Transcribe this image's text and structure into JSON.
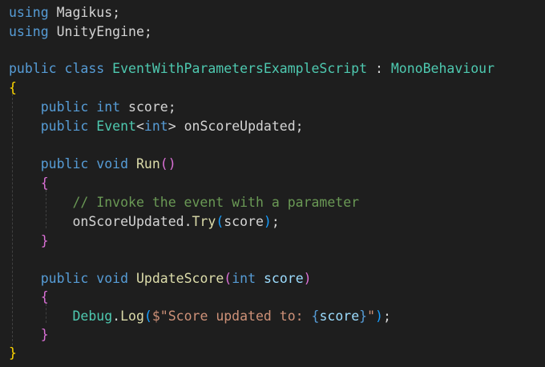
{
  "code": {
    "l1": {
      "kw": "using",
      "ns": "Magikus",
      "semi": ";"
    },
    "l2": {
      "kw": "using",
      "ns": "UnityEngine",
      "semi": ";"
    },
    "l4": {
      "kw1": "public",
      "kw2": "class",
      "name": "EventWithParametersExampleScript",
      "colon": ":",
      "base": "MonoBehaviour"
    },
    "l5": {
      "brace": "{"
    },
    "l6": {
      "kw1": "public",
      "kw2": "int",
      "field": "score",
      "semi": ";"
    },
    "l7": {
      "kw1": "public",
      "type": "Event",
      "lt": "<",
      "targ": "int",
      "gt": ">",
      "field": "onScoreUpdated",
      "semi": ";"
    },
    "l9": {
      "kw1": "public",
      "kw2": "void",
      "name": "Run",
      "parens": "()"
    },
    "l10": {
      "brace": "{"
    },
    "l11": {
      "comment": "// Invoke the event with a parameter"
    },
    "l12": {
      "obj": "onScoreUpdated",
      "dot": ".",
      "method": "Try",
      "open": "(",
      "arg": "score",
      "close": ")",
      "semi": ";"
    },
    "l13": {
      "brace": "}"
    },
    "l15": {
      "kw1": "public",
      "kw2": "void",
      "name": "UpdateScore",
      "open": "(",
      "ptype": "int",
      "pname": "score",
      "close": ")"
    },
    "l16": {
      "brace": "{"
    },
    "l17": {
      "obj": "Debug",
      "dot": ".",
      "method": "Log",
      "open": "(",
      "str1": "$\"Score updated to: ",
      "ib_open": "{",
      "ivar": "score",
      "ib_close": "}",
      "str2": "\"",
      "close": ")",
      "semi": ";"
    },
    "l18": {
      "brace": "}"
    },
    "l19": {
      "brace": "}"
    }
  }
}
